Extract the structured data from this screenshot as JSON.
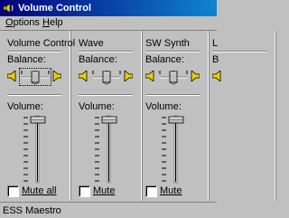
{
  "window": {
    "title": "Volume Control",
    "icon": "speaker-icon"
  },
  "menu": [
    "Options",
    "Help"
  ],
  "channels": [
    {
      "name": "Volume Control",
      "balance_label": "Balance:",
      "volume_label": "Volume:",
      "mute_label": "Mute all",
      "muted": false,
      "balance_focused": true
    },
    {
      "name": "Wave",
      "balance_label": "Balance:",
      "volume_label": "Volume:",
      "mute_label": "Mute",
      "muted": false,
      "balance_focused": false
    },
    {
      "name": "SW Synth",
      "balance_label": "Balance:",
      "volume_label": "Volume:",
      "mute_label": "Mute",
      "muted": false,
      "balance_focused": false
    },
    {
      "name": "L",
      "balance_label": "B",
      "volume_label": "",
      "mute_label": "",
      "muted": false,
      "balance_focused": false
    }
  ],
  "status_bar": {
    "text": "ESS Maestro"
  },
  "colors": {
    "title_start": "#00007b",
    "title_end": "#1084d0",
    "face": "#c0c0c0",
    "speaker": "#e8d000"
  }
}
